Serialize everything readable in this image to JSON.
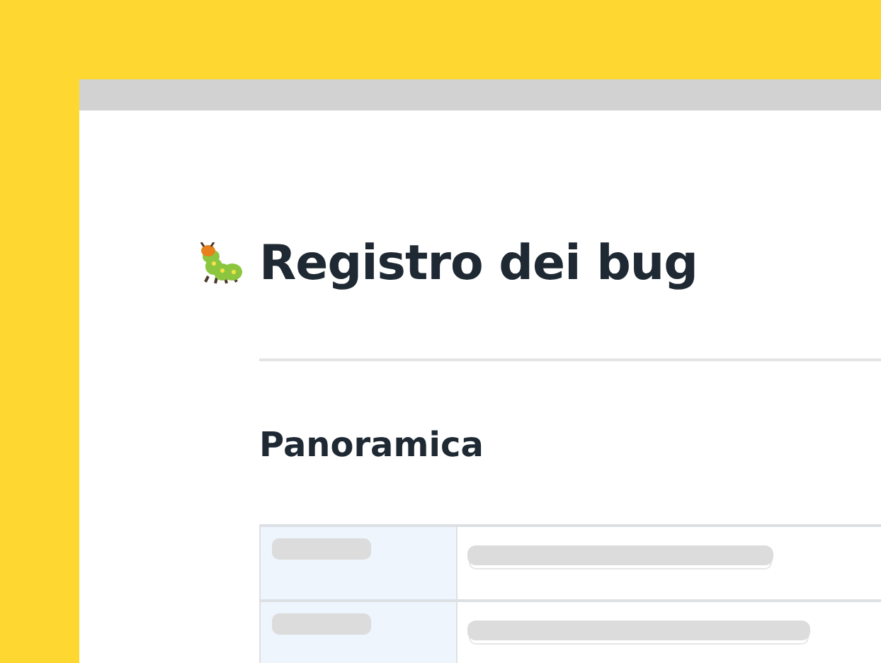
{
  "page": {
    "title": "Registro dei bug",
    "section_heading": "Panoramica"
  },
  "table": {
    "rows": [
      {
        "kind": "placeholder"
      },
      {
        "kind": "placeholder"
      }
    ]
  }
}
